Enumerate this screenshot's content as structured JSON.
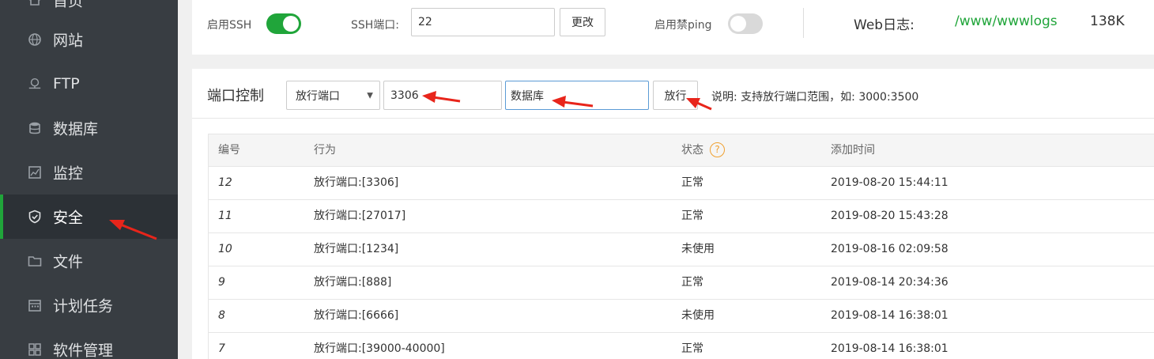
{
  "sidebar": {
    "items": [
      {
        "label": "首页",
        "icon": "home-icon"
      },
      {
        "label": "网站",
        "icon": "globe-icon"
      },
      {
        "label": "FTP",
        "icon": "ftp-icon"
      },
      {
        "label": "数据库",
        "icon": "database-icon"
      },
      {
        "label": "监控",
        "icon": "monitor-icon"
      },
      {
        "label": "安全",
        "icon": "shield-icon",
        "active": true
      },
      {
        "label": "文件",
        "icon": "folder-icon"
      },
      {
        "label": "计划任务",
        "icon": "calendar-icon"
      },
      {
        "label": "软件管理",
        "icon": "apps-icon"
      }
    ]
  },
  "top": {
    "ssh_label": "启用SSH",
    "ssh_enabled": true,
    "ssh_port_label": "SSH端口:",
    "ssh_port_value": "22",
    "change_button": "更改",
    "ping_label": "启用禁ping",
    "ping_enabled": false,
    "web_log_label": "Web日志:",
    "web_log_path": "/www/wwwlogs",
    "web_log_size": "138K"
  },
  "port_control": {
    "title": "端口控制",
    "select_value": "放行端口",
    "port_value": "3306",
    "remark_value": "数据库",
    "submit_button": "放行",
    "hint": "说明: 支持放行端口范围，如: 3000:3500"
  },
  "table": {
    "headers": [
      "编号",
      "行为",
      "状态",
      "添加时间"
    ],
    "rows": [
      {
        "id": "12",
        "action": "放行端口:[3306]",
        "status": "正常",
        "time": "2019-08-20 15:44:11"
      },
      {
        "id": "11",
        "action": "放行端口:[27017]",
        "status": "正常",
        "time": "2019-08-20 15:43:28"
      },
      {
        "id": "10",
        "action": "放行端口:[1234]",
        "status": "未使用",
        "time": "2019-08-16 02:09:58"
      },
      {
        "id": "9",
        "action": "放行端口:[888]",
        "status": "正常",
        "time": "2019-08-14 20:34:36"
      },
      {
        "id": "8",
        "action": "放行端口:[6666]",
        "status": "未使用",
        "time": "2019-08-14 16:38:01"
      },
      {
        "id": "7",
        "action": "放行端口:[39000-40000]",
        "status": "正常",
        "time": "2019-08-14 16:38:01"
      }
    ]
  },
  "colors": {
    "accent": "#20a53a",
    "sidebar_bg": "#383d42",
    "annotation_arrow": "#e8251b",
    "help_icon": "#f0a030"
  }
}
